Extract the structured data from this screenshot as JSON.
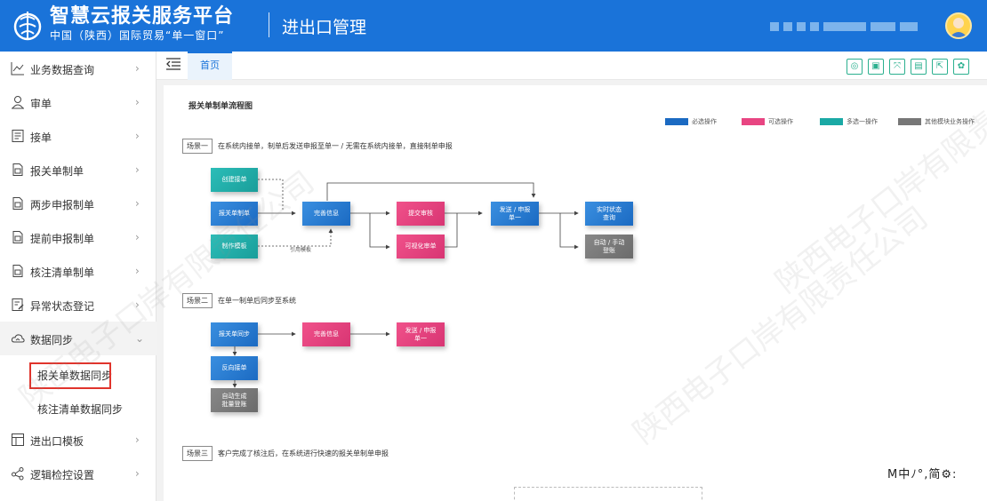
{
  "header": {
    "title": "智慧云报关服务平台",
    "subtitle": "中国（陕西）国际贸易“单一窗口”",
    "module": "进出口管理"
  },
  "sidebar": {
    "items": [
      {
        "label": "业务数据查询",
        "icon": "chart-line-icon",
        "chevron": "›"
      },
      {
        "label": "审单",
        "icon": "user-review-icon",
        "chevron": "›"
      },
      {
        "label": "接单",
        "icon": "document-list-icon",
        "chevron": "›"
      },
      {
        "label": "报关单制单",
        "icon": "document-icon",
        "chevron": "›"
      },
      {
        "label": "两步申报制单",
        "icon": "document-icon",
        "chevron": "›"
      },
      {
        "label": "提前申报制单",
        "icon": "document-icon",
        "chevron": "›"
      },
      {
        "label": "核注清单制单",
        "icon": "document-icon",
        "chevron": "›"
      },
      {
        "label": "异常状态登记",
        "icon": "edit-document-icon",
        "chevron": "›"
      },
      {
        "label": "数据同步",
        "icon": "cloud-sync-icon",
        "chevron": "⌄"
      },
      {
        "label": "进出口模板",
        "icon": "template-icon",
        "chevron": "›"
      },
      {
        "label": "逻辑检控设置",
        "icon": "share-nodes-icon",
        "chevron": "›"
      }
    ],
    "subitems": [
      {
        "label": "报关单数据同步",
        "selected": true
      },
      {
        "label": "核注清单数据同步",
        "selected": false
      }
    ]
  },
  "tabs": {
    "home": "首页"
  },
  "toolbar": {
    "icons": [
      "refresh-icon",
      "fullscreen-toggle-icon",
      "expand-icon",
      "save-icon",
      "export-icon",
      "settings-icon"
    ],
    "glyphs": [
      "◎",
      "▣",
      "⤧",
      "▤",
      "⇱",
      "✿"
    ]
  },
  "flow": {
    "title": "报关单制单流程图",
    "legend": [
      {
        "label": "必选操作",
        "color": "#1b6ac2"
      },
      {
        "label": "可选操作",
        "color": "#e84582"
      },
      {
        "label": "多选一操作",
        "color": "#1aa9a5"
      },
      {
        "label": "其他模块业务操作",
        "color": "#777777"
      }
    ],
    "scene1": {
      "tag": "场景一",
      "text": "在系统内接单，制单后发送申报至单一 / 无需在系统内接单，直接制单申报",
      "create_order": "创建接单",
      "declaration": "报关单制单",
      "template": "制作模板",
      "complete_info": "完善信息",
      "submit_review": "提交审核",
      "visual_review": "可视化审单",
      "send_declare_line1": "发送 / 申报",
      "send_declare_line2": "单一",
      "realtime_line1": "实时状态",
      "realtime_line2": "查询",
      "auto_manual_line1": "自动 / 手动",
      "auto_manual_line2": "登账",
      "ref_template": "引用模板"
    },
    "scene2": {
      "tag": "场景二",
      "text": "在单一制单后同步至系统",
      "sync": "报关单同步",
      "complete_info": "完善信息",
      "send_line1": "发送 / 申报",
      "send_line2": "单一",
      "reverse": "反向接单",
      "auto_gen_line1": "自动生成",
      "auto_gen_line2": "批量登账"
    },
    "scene3": {
      "tag": "场景三",
      "text": "客户完成了核注后，在系统进行快速的报关单制单申报"
    }
  },
  "ime": {
    "text": "M中ﾉ°,简⚙:"
  },
  "watermark": "陕西电子口岸有限责任公司"
}
